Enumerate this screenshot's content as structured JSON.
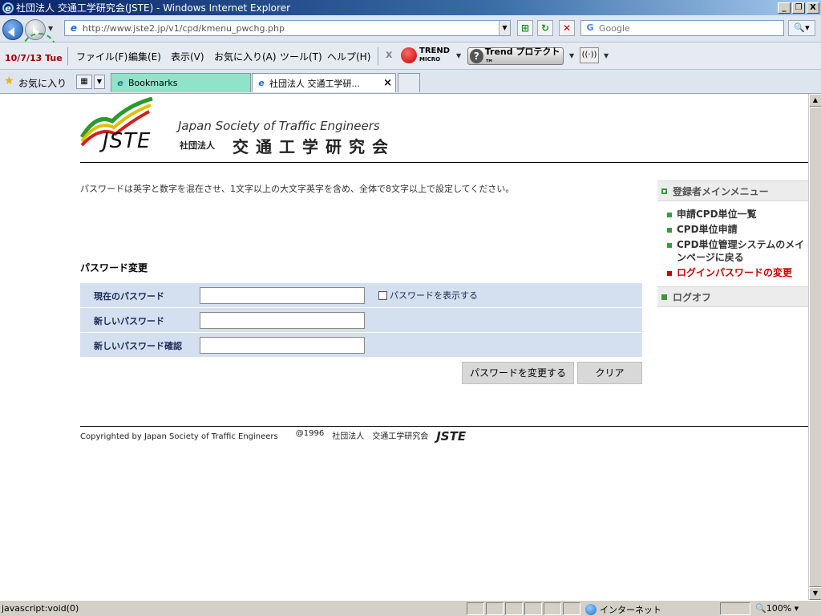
{
  "window": {
    "title": "社団法人 交通工学研究会(JSTE) - Windows Internet Explorer",
    "minimize": "_",
    "maximize": "❐",
    "close": "X"
  },
  "address_bar": {
    "url": "http://www.jste2.jp/v1/cpd/kmenu_pwchg.php",
    "search_placeholder": "Google"
  },
  "menu_bar": {
    "date": "10/7/13 Tue",
    "items": [
      "ファイル(F)",
      "編集(E)",
      "表示(V)",
      "お気に入り(A)",
      "ツール(T)",
      "ヘルプ(H)"
    ],
    "trend_logo": "TREND",
    "trend_logo_sub": "MICRO",
    "trend_button": "Trend プロテクト™"
  },
  "tabs_bar": {
    "favorites_label": "お気に入り",
    "tabs": [
      {
        "label": "Bookmarks"
      },
      {
        "label": "社団法人 交通工学研..."
      }
    ]
  },
  "header": {
    "society_en": "Japan Society of Traffic Engineers",
    "society_prefix": "社団法人",
    "society_jp": "交通工学研究会",
    "logo_text": "JSTE"
  },
  "page": {
    "notice": "パスワードは英字と数字を混在させ、1文字以上の大文字英字を含め、全体で8文字以上で設定してください。",
    "section_title": "パスワード変更",
    "fields": [
      {
        "label": "現在のパスワード",
        "value": ""
      },
      {
        "label": "新しいパスワード",
        "value": ""
      },
      {
        "label": "新しいパスワード確認",
        "value": ""
      }
    ],
    "show_password_label": "パスワードを表示する",
    "change_button": "パスワードを変更する",
    "clear_button": "クリア"
  },
  "side_menu": {
    "heading": "登録者メインメニュー",
    "items": [
      {
        "label": "申請CPD単位一覧",
        "active": false
      },
      {
        "label": "CPD単位申請",
        "active": false
      },
      {
        "label": "CPD単位管理システムのメインページに戻る",
        "active": false
      },
      {
        "label": "ログインパスワードの変更",
        "active": true
      }
    ],
    "logoff": "ログオフ"
  },
  "footer": {
    "copyright": "Copyrighted by Japan Society of Traffic Engineers",
    "year": "@1996",
    "org_prefix": "社団法人",
    "org_name": "交通工学研究会",
    "logo": "JSTE"
  },
  "status_bar": {
    "status": "javascript:void(0)",
    "zone": "インターネット",
    "zoom": "100%"
  },
  "colors": {
    "accent_green": "#3a9a3a",
    "active_red": "#cc0000",
    "form_bg": "#d4e0f0",
    "bookmarks_tab": "#8fe3c8"
  }
}
